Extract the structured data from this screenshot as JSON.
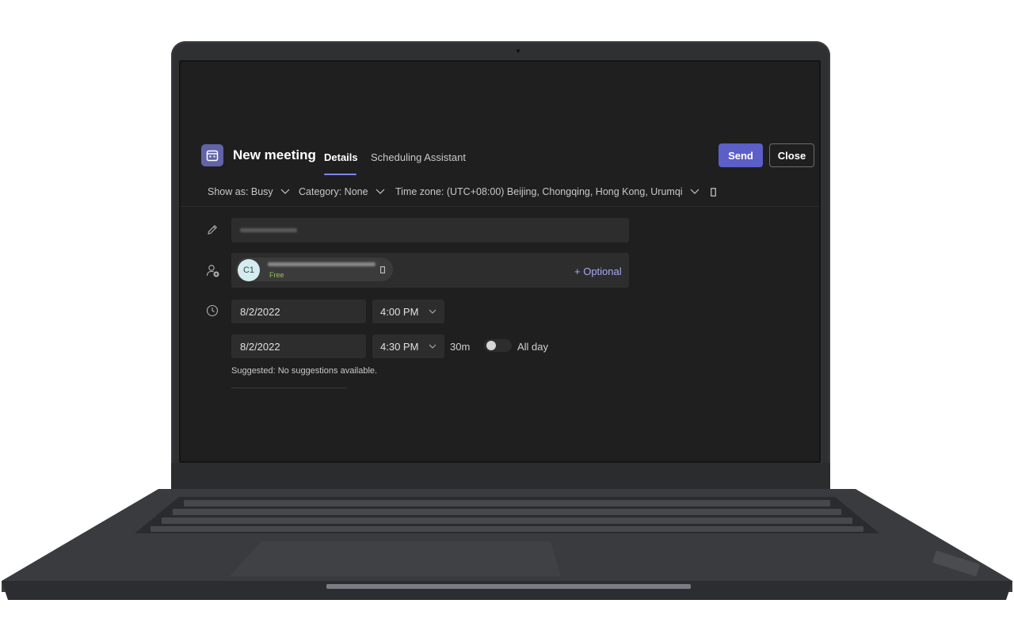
{
  "app": {
    "title": "New meeting",
    "icon": "calendar-icon",
    "accent": "#5b5fc7"
  },
  "tabs": [
    {
      "label": "Details",
      "active": true
    },
    {
      "label": "Scheduling Assistant",
      "active": false
    }
  ],
  "actions": {
    "send_label": "Send",
    "close_label": "Close"
  },
  "options": {
    "show_as": "Show as: Busy",
    "category": "Category: None",
    "time_zone": "Time zone: (UTC+08:00) Beijing, Chongqing, Hong Kong, Urumqi"
  },
  "attendee": {
    "initials": "C1",
    "status": "Free",
    "optional_label": "+ Optional"
  },
  "start": {
    "date": "8/2/2022",
    "time": "4:00 PM"
  },
  "end": {
    "date": "8/2/2022",
    "time": "4:30 PM"
  },
  "duration": "30m",
  "all_day": {
    "label": "All day",
    "on": false
  },
  "suggested_text": "Suggested: No suggestions available."
}
